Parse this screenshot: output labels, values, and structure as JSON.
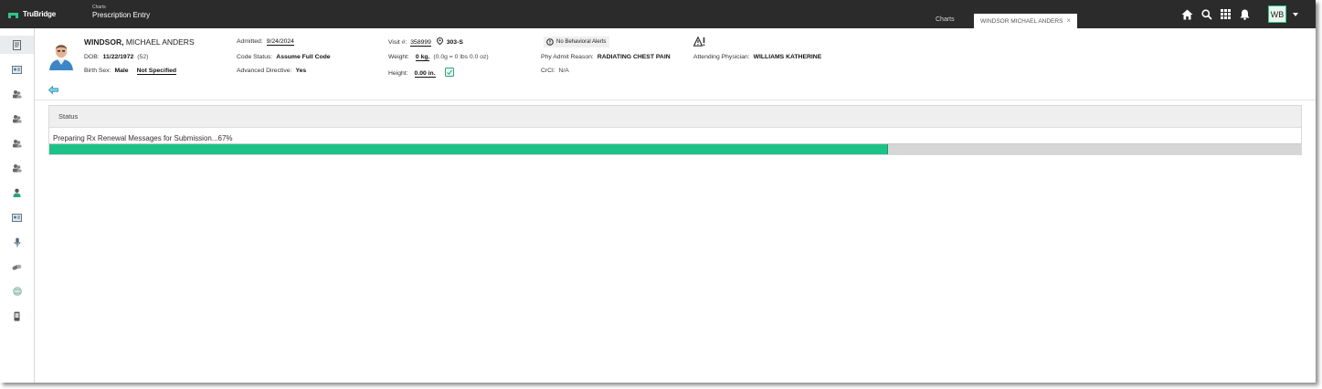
{
  "brand": {
    "name": "TruBridge"
  },
  "app": {
    "context": "Charts",
    "title": "Prescription Entry"
  },
  "tabs": [
    {
      "label": "Charts"
    },
    {
      "label": "WINDSOR MICHAEL ANDERS",
      "close": "×"
    }
  ],
  "top_icons": [
    "home-icon",
    "search-icon",
    "apps-grid-icon",
    "bell-icon"
  ],
  "user": {
    "initials": "WB"
  },
  "patient": {
    "last_name": "WINDSOR,",
    "first_name": "MICHAEL ANDERS",
    "dob_label": "DOB:",
    "dob": "11/22/1972",
    "age": "(52)",
    "birth_sex_label": "Birth Sex:",
    "birth_sex": "Male",
    "gender_identity": "Not Specified",
    "admitted_label": "Admitted:",
    "admitted": "9/24/2024",
    "code_status_label": "Code Status:",
    "code_status": "Assume Full Code",
    "adv_directive_label": "Advanced Directive:",
    "adv_directive": "Yes",
    "visit_label": "Visit #:",
    "visit": "358999",
    "room": "303-S",
    "weight_label": "Weight:",
    "weight": "0 kg.",
    "weight_detail": "(0.0g = 0 lbs 0.0 oz)",
    "height_label": "Height:",
    "height": "0.00 in.",
    "alerts": "No Behavioral Alerts",
    "admit_reason_label": "Phy Admit Reason:",
    "admit_reason": "RADIATING CHEST PAIN",
    "crcl_label": "CrCl:",
    "crcl": "N/A",
    "attending_label": "Attending Physician:",
    "attending": "WILLIAMS KATHERINE"
  },
  "status_panel": {
    "title": "Status",
    "message": "Preparing Rx Renewal Messages for Submission...67%",
    "progress": 0.67
  },
  "colors": {
    "topbar": "#2b2b2b",
    "accent": "#1dc288"
  }
}
